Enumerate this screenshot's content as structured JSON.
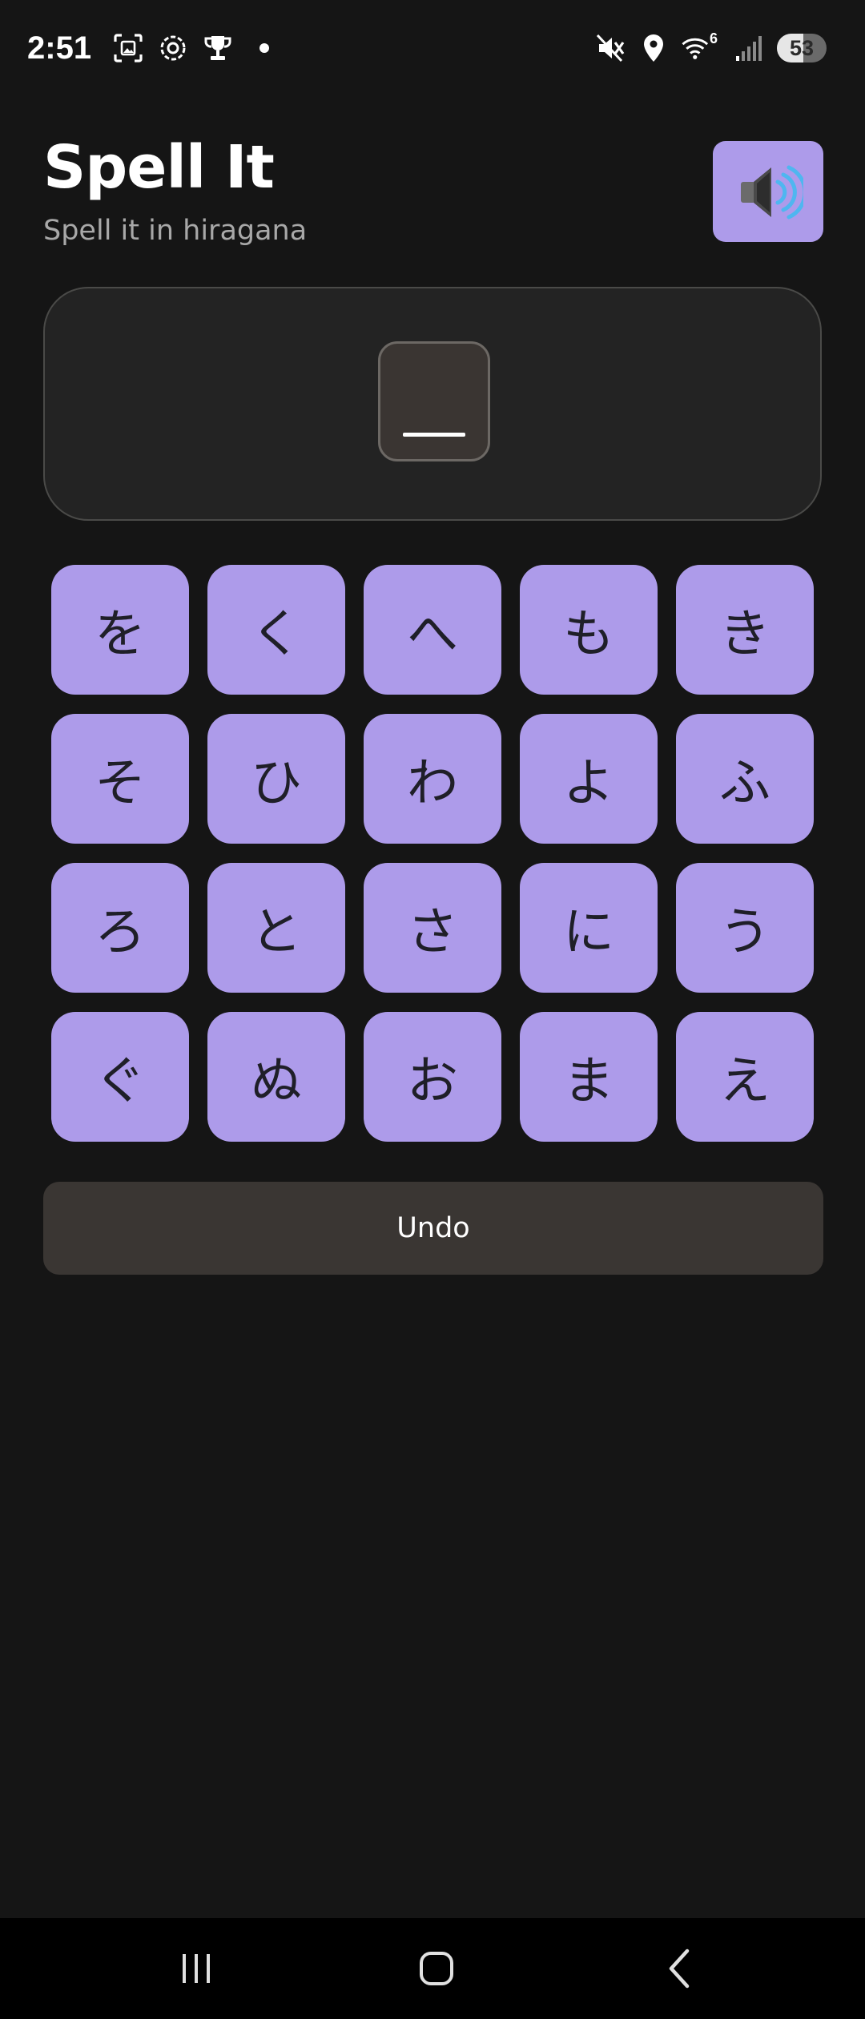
{
  "status_bar": {
    "time": "2:51",
    "left_icons": [
      "screenshot-icon",
      "settings-gear-icon",
      "trophy-icon"
    ],
    "right_icons": [
      "mute-icon",
      "location-icon",
      "wifi-icon",
      "signal-icon"
    ],
    "wifi_badge": "6",
    "battery_level": "53"
  },
  "header": {
    "title": "Spell It",
    "subtitle": "Spell it in hiragana",
    "speaker_icon": "speaker-icon"
  },
  "answer": {
    "slots": [
      "_"
    ]
  },
  "keyboard": {
    "keys": [
      "を",
      "く",
      "へ",
      "も",
      "き",
      "そ",
      "ひ",
      "わ",
      "よ",
      "ふ",
      "ろ",
      "と",
      "さ",
      "に",
      "う",
      "ぐ",
      "ぬ",
      "お",
      "ま",
      "え"
    ]
  },
  "undo_label": "Undo",
  "nav_bar": {
    "items": [
      "recents-icon",
      "home-icon",
      "back-icon"
    ]
  },
  "colors": {
    "background": "#151515",
    "accent": "#ad9bea",
    "card": "#232323",
    "undo": "#3a3633"
  }
}
